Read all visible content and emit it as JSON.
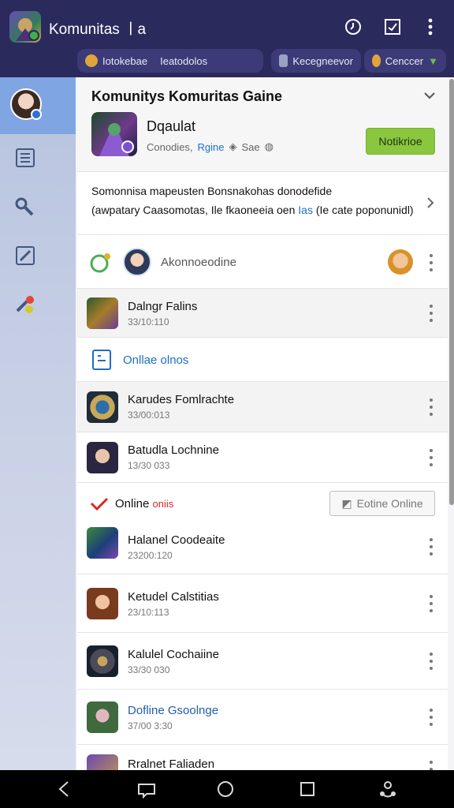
{
  "app": {
    "title": "Komunitas ㅣa"
  },
  "appbar_icons": [
    "history-icon",
    "edit-square-icon",
    "more-vert-icon"
  ],
  "chips": [
    {
      "label": "Iotokebae",
      "label2": "Ieatodolos"
    },
    {
      "label": "Kecegneevor"
    },
    {
      "label": "Cenccer"
    }
  ],
  "header": {
    "title": "Komunitys Komuritas Gaine",
    "game_name": "Dqaulat",
    "meta_1": "Conodies,",
    "meta_2": "Rgine",
    "meta_3": "Sae",
    "notify_label": "Notikrioe"
  },
  "description": {
    "line1": "Somonnisa mapeusten Bonsnakohas donodefide",
    "line2_a": "(awpatary Caasomotas, Ile fkaoneeia oen",
    "line2_hl": "Ias",
    "line2_b": "(Ie cate poponunidl)"
  },
  "online_strip": {
    "label": "Akonnoeodine"
  },
  "items": [
    {
      "title": "Dalngr Falins",
      "sub": "33/10:110"
    },
    {
      "title": "Karudes Fomlrachte",
      "sub": "33/00:013"
    },
    {
      "title": "Batudla Lochnine",
      "sub": "13/30 033"
    },
    {
      "title": "Halanel Coodeaite",
      "sub": "23200:120"
    },
    {
      "title": "Ketudel Calstitias",
      "sub": "23/10:113"
    },
    {
      "title": "Kalulel Cochaiine",
      "sub": "33/30 030"
    },
    {
      "title": "Dofline Gsoolnge",
      "sub": "37/00 3:30"
    },
    {
      "title": "Rralnet Faliaden",
      "sub": ""
    }
  ],
  "section_online": {
    "label": "Onllae olnos"
  },
  "section_online2": {
    "label_a": "Online",
    "label_b": "oniis",
    "button": "Eotine Online"
  },
  "colors": {
    "appbar": "#2b2a5c",
    "accent_green": "#8bc63f",
    "link_blue": "#1f6fc4",
    "alert_red": "#d12b2b"
  }
}
